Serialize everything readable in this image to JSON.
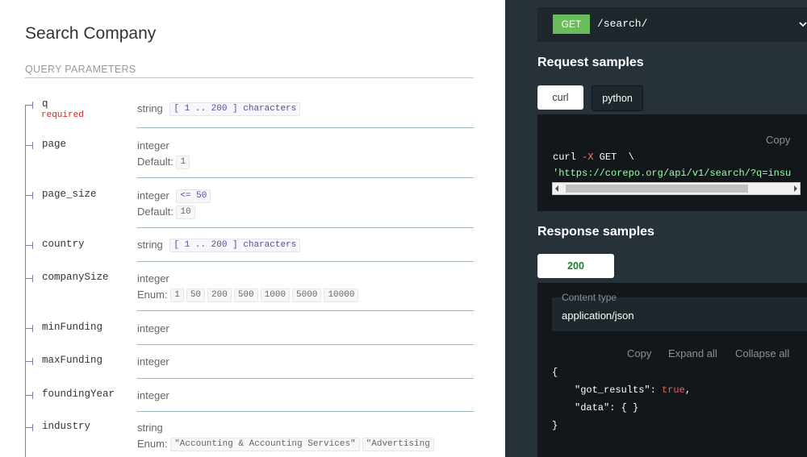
{
  "left": {
    "title": "Search Company",
    "section_label": "QUERY PARAMETERS",
    "params": [
      {
        "name": "q",
        "required_label": "required",
        "type": "string",
        "constraint": "[ 1 .. 200 ] characters"
      },
      {
        "name": "page",
        "type": "integer",
        "default_label": "Default:",
        "default": "1"
      },
      {
        "name": "page_size",
        "type": "integer",
        "constraint": "<= 50",
        "default_label": "Default:",
        "default": "10"
      },
      {
        "name": "country",
        "type": "string",
        "constraint": "[ 1 .. 200 ] characters"
      },
      {
        "name": "companySize",
        "type": "integer",
        "enum_label": "Enum:",
        "enum": [
          "1",
          "50",
          "200",
          "500",
          "1000",
          "5000",
          "10000"
        ]
      },
      {
        "name": "minFunding",
        "type": "integer"
      },
      {
        "name": "maxFunding",
        "type": "integer"
      },
      {
        "name": "foundingYear",
        "type": "integer"
      },
      {
        "name": "industry",
        "type": "string",
        "enum_label": "Enum:",
        "enum": [
          "\"Accounting & Accounting Services\"",
          "\"Advertising"
        ]
      }
    ]
  },
  "right": {
    "method": "GET",
    "path": "/search/",
    "request_samples_title": "Request samples",
    "request_tabs": [
      {
        "label": "curl",
        "active": true
      },
      {
        "label": "python",
        "active": false
      }
    ],
    "copy_label": "Copy",
    "curl_line1_cmd": "curl ",
    "curl_line1_op": "-X",
    "curl_line1_rest": " GET  \\",
    "curl_line2": "'https://corepo.org/api/v1/search/?q=insu",
    "response_samples_title": "Response samples",
    "response_tab": "200",
    "content_type_label": "Content type",
    "content_type_value": "application/json",
    "actions": {
      "copy": "Copy",
      "expand": "Expand all",
      "collapse": "Collapse all"
    },
    "json": {
      "open": "{",
      "key1": "\"got_results\"",
      "colon": ": ",
      "val1": "true",
      "comma": ",",
      "key2": "\"data\"",
      "val2": "{ }",
      "close": "}"
    }
  },
  "colors": {
    "get_badge": "#6bbd5b",
    "dark_panel": "#263238",
    "code_bg": "#11171a",
    "required": "#d41f1c",
    "status_200": "#1d8127",
    "json_true": "#ef5f5f",
    "curl_string": "#a0fbaa"
  },
  "icons": {
    "expand": "chevron-down-icon",
    "scroll_left": "scroll-left-arrow-icon",
    "scroll_right": "scroll-right-arrow-icon"
  }
}
